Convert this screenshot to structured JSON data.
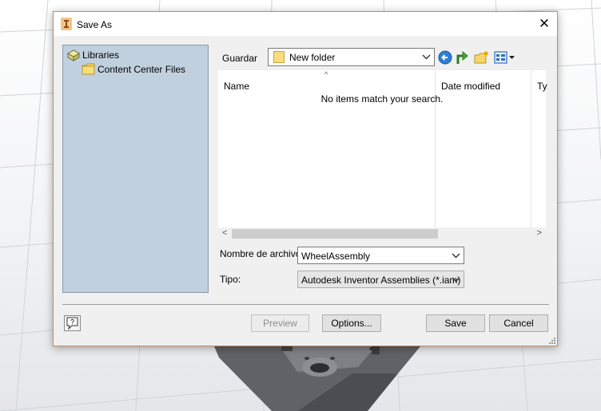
{
  "dialog": {
    "title": "Save As",
    "close_glyph": "✕"
  },
  "places": {
    "items": [
      {
        "label": "Libraries",
        "icon": "libraries-icon"
      },
      {
        "label": "Content Center Files",
        "icon": "folder-icon"
      }
    ]
  },
  "lookin": {
    "label": "Guardar",
    "value": "New folder"
  },
  "toolbar": {
    "back_icon": "back-arrow-icon",
    "up_icon": "up-folder-icon",
    "new_folder_icon": "new-folder-icon",
    "view_icon": "view-menu-icon"
  },
  "filelist": {
    "columns": [
      "Name",
      "Date modified",
      "Ty"
    ],
    "empty_message": "No items match your search.",
    "scroll_left": "<",
    "scroll_right": ">",
    "sort_glyph": "^"
  },
  "form": {
    "filename_label": "Nombre de archivo:",
    "filename_value": "WheelAssembly",
    "type_label": "Tipo:",
    "type_value": "Autodesk Inventor Assemblies (*.iam)"
  },
  "buttons": {
    "preview": "Preview",
    "options": "Options...",
    "save": "Save",
    "cancel": "Cancel",
    "help_glyph": "?"
  },
  "colors": {
    "accent_border": "#c98a5b",
    "places_bg": "#c0d0de",
    "folder_yellow": "#f5d66a",
    "back_blue": "#2f7fd4",
    "up_green": "#4aa83a"
  }
}
